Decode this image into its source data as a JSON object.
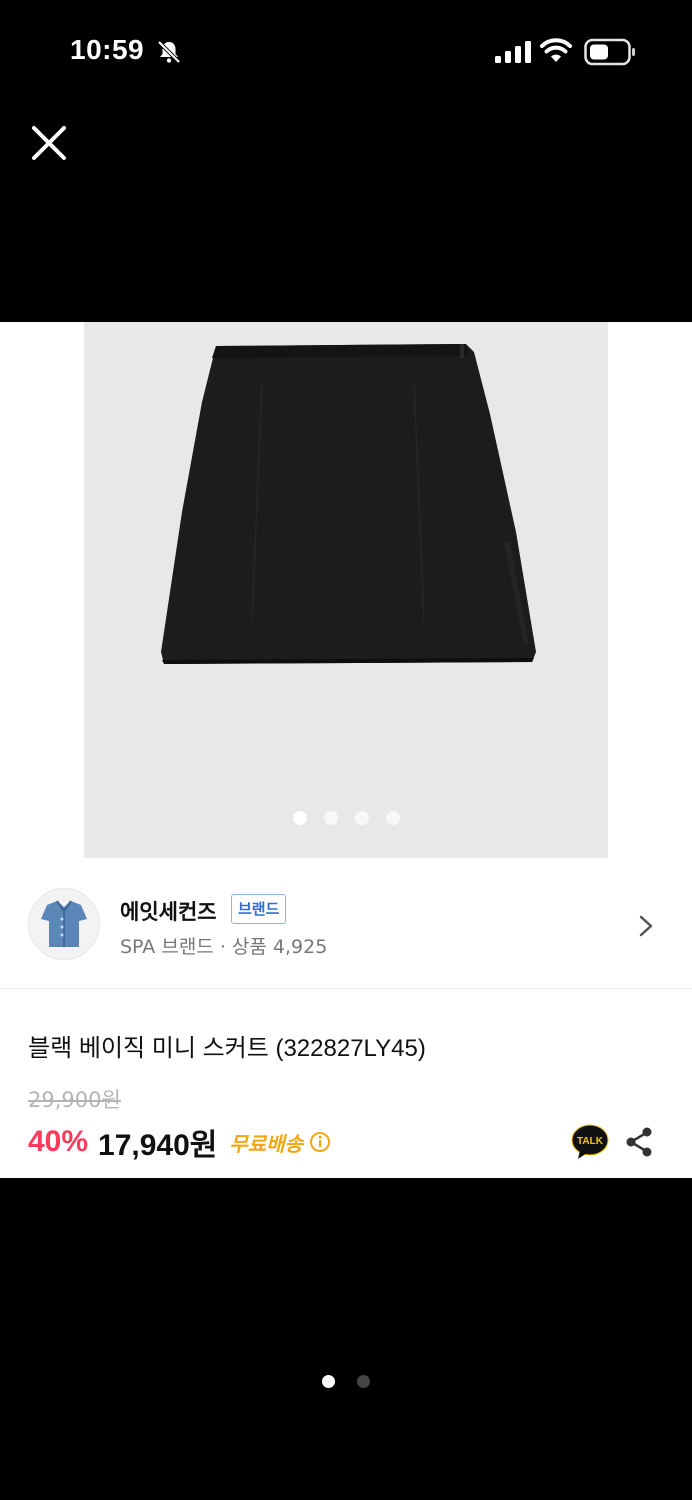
{
  "status_bar": {
    "time": "10:59"
  },
  "icons": {
    "close": "close-icon",
    "bell_muted": "bell-slash-icon",
    "signal": "signal-icon",
    "wifi": "wifi-icon",
    "battery": "battery-icon",
    "chevron": "chevron-right-icon",
    "info": "info-icon",
    "talk": "kakaotalk-icon",
    "share": "share-icon"
  },
  "product_image": {
    "dot_count": 4,
    "active_index": 0
  },
  "brand": {
    "name": "에잇세컨즈",
    "badge": "브랜드",
    "sub": "SPA 브랜드 · 상품 4,925"
  },
  "product": {
    "title": "블랙 베이직 미니 스커트 (322827LY45)",
    "original_price": "29,900원",
    "discount_rate": "40%",
    "sale_price": "17,940원",
    "shipping": "무료배송",
    "talk_label": "TALK"
  },
  "page_indicator": {
    "count": 2,
    "active_index": 0
  },
  "colors": {
    "discount": "#ff3b5c",
    "shipping": "#f2a612",
    "badge": "#2f6fd6",
    "talk_bg": "#111111",
    "talk_border": "#f7c600"
  }
}
